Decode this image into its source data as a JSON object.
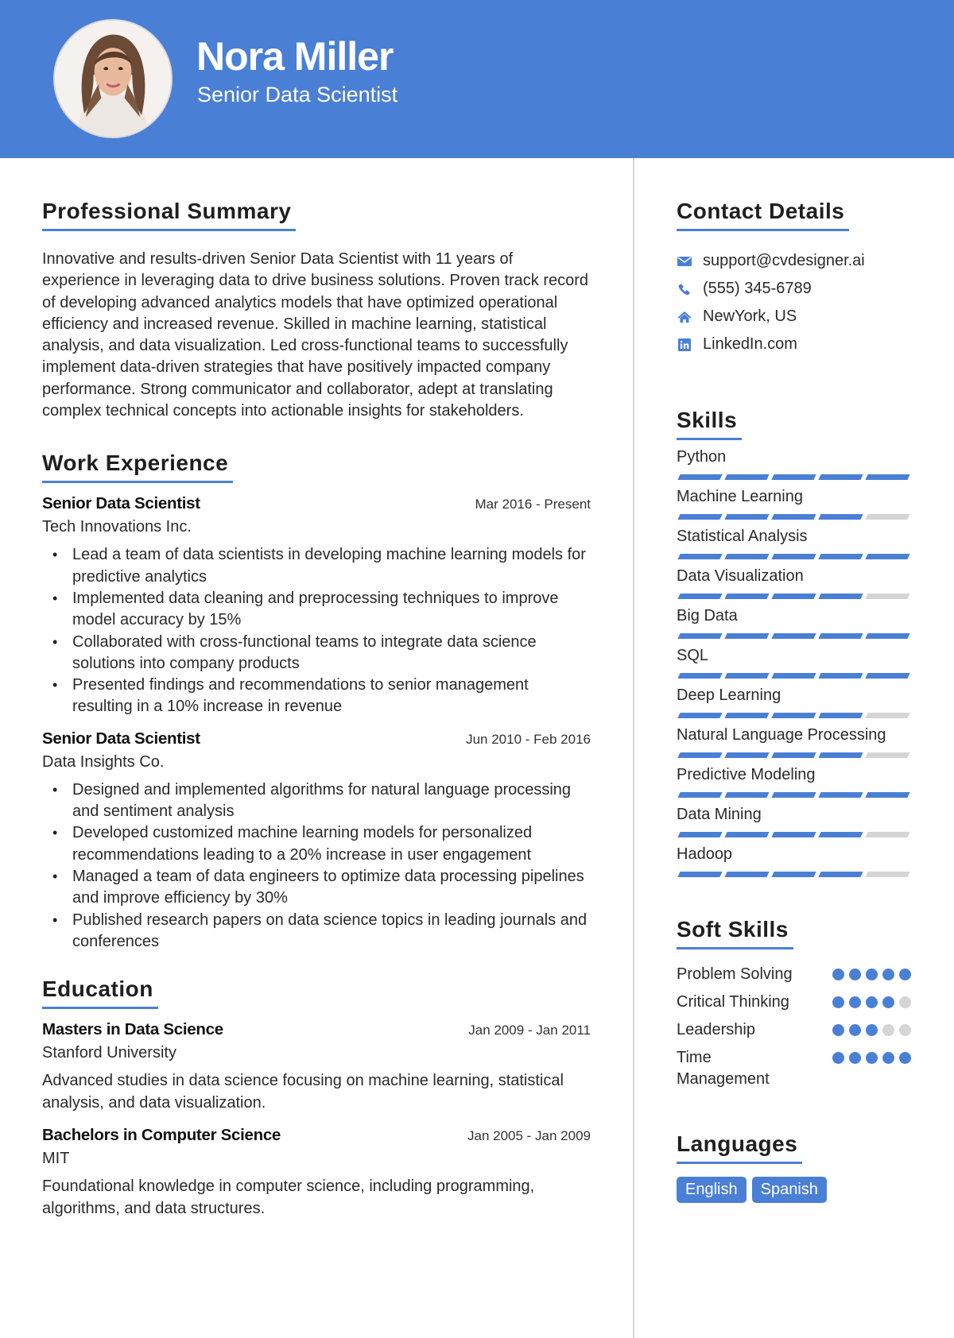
{
  "header": {
    "name": "Nora Miller",
    "title": "Senior Data Scientist"
  },
  "colors": {
    "accent": "#4a7fd6",
    "inactive": "#d5d5d5"
  },
  "summary": {
    "heading": "Professional Summary",
    "text": "Innovative and results-driven Senior Data Scientist with 11 years of experience in leveraging data to drive business solutions. Proven track record of developing advanced analytics models that have optimized operational efficiency and increased revenue. Skilled in machine learning, statistical analysis, and data visualization. Led cross-functional teams to successfully implement data-driven strategies that have positively impacted company performance. Strong communicator and collaborator, adept at translating complex technical concepts into actionable insights for stakeholders."
  },
  "experience": {
    "heading": "Work Experience",
    "jobs": [
      {
        "title": "Senior Data Scientist",
        "dates": "Mar 2016 - Present",
        "company": "Tech Innovations Inc.",
        "bullets": [
          "Lead a team of data scientists in developing machine learning models for predictive analytics",
          "Implemented data cleaning and preprocessing techniques to improve model accuracy by 15%",
          "Collaborated with cross-functional teams to integrate data science solutions into company products",
          "Presented findings and recommendations to senior management resulting in a 10% increase in revenue"
        ]
      },
      {
        "title": "Senior Data Scientist",
        "dates": "Jun 2010 - Feb 2016",
        "company": "Data Insights Co.",
        "bullets": [
          "Designed and implemented algorithms for natural language processing and sentiment analysis",
          "Developed customized machine learning models for personalized recommendations leading to a 20% increase in user engagement",
          "Managed a team of data engineers to optimize data processing pipelines and improve efficiency by 30%",
          "Published research papers on data science topics in leading journals and conferences"
        ]
      }
    ]
  },
  "education": {
    "heading": "Education",
    "items": [
      {
        "degree": "Masters in Data Science",
        "dates": "Jan 2009 - Jan 2011",
        "school": "Stanford University",
        "description": "Advanced studies in data science focusing on machine learning, statistical analysis, and data visualization."
      },
      {
        "degree": "Bachelors in Computer Science",
        "dates": "Jan 2005 - Jan 2009",
        "school": "MIT",
        "description": "Foundational knowledge in computer science, including programming, algorithms, and data structures."
      }
    ]
  },
  "contact": {
    "heading": "Contact Details",
    "items": [
      {
        "icon": "envelope-icon",
        "text": "support@cvdesigner.ai"
      },
      {
        "icon": "phone-icon",
        "text": "(555) 345-6789"
      },
      {
        "icon": "home-icon",
        "text": "NewYork, US"
      },
      {
        "icon": "linkedin-icon",
        "text": "LinkedIn.com"
      }
    ]
  },
  "skills": {
    "heading": "Skills",
    "max": 5,
    "items": [
      {
        "name": "Python",
        "level": 5
      },
      {
        "name": "Machine Learning",
        "level": 4
      },
      {
        "name": "Statistical Analysis",
        "level": 5
      },
      {
        "name": "Data Visualization",
        "level": 4
      },
      {
        "name": "Big Data",
        "level": 5
      },
      {
        "name": "SQL",
        "level": 5
      },
      {
        "name": "Deep Learning",
        "level": 4
      },
      {
        "name": "Natural Language Processing",
        "level": 4
      },
      {
        "name": "Predictive Modeling",
        "level": 5
      },
      {
        "name": "Data Mining",
        "level": 4
      },
      {
        "name": "Hadoop",
        "level": 4
      }
    ]
  },
  "soft_skills": {
    "heading": "Soft Skills",
    "max": 5,
    "items": [
      {
        "name": "Problem Solving",
        "level": 5
      },
      {
        "name": "Critical Thinking",
        "level": 4
      },
      {
        "name": "Leadership",
        "level": 3
      },
      {
        "name": "Time Management",
        "level": 5
      }
    ]
  },
  "languages": {
    "heading": "Languages",
    "items": [
      "English",
      "Spanish"
    ]
  }
}
